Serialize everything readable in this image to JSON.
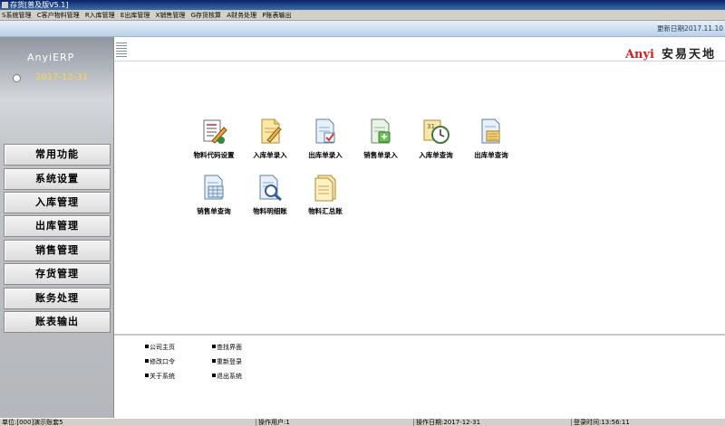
{
  "window": {
    "title": "存货[普及版V5.1]"
  },
  "menu": [
    "S系统管理",
    "C客户物料管理",
    "R入库管理",
    "E出库管理",
    "X销售管理",
    "G存货核算",
    "A财务处理",
    "P账表输出"
  ],
  "header": {
    "update_date": "更新日期2017.11.10"
  },
  "sidebar": {
    "brand": "AnyiERP",
    "date": "2017-12-31",
    "items": [
      "常用功能",
      "系统设置",
      "入库管理",
      "出库管理",
      "销售管理",
      "存货管理",
      "账务处理",
      "账表输出"
    ]
  },
  "main": {
    "logo_latin": "Anyi",
    "logo_cn": "安易天地",
    "shortcuts": [
      {
        "label": "物料代码设置",
        "icon": "material-code-icon"
      },
      {
        "label": "入库单录入",
        "icon": "inbound-entry-icon"
      },
      {
        "label": "出库单录入",
        "icon": "outbound-entry-icon"
      },
      {
        "label": "销售单录入",
        "icon": "sales-entry-icon"
      },
      {
        "label": "入库单查询",
        "icon": "inbound-query-icon"
      },
      {
        "label": "出库单查询",
        "icon": "outbound-query-icon"
      },
      {
        "label": "销售单查询",
        "icon": "sales-query-icon"
      },
      {
        "label": "物料明细账",
        "icon": "material-ledger-icon"
      },
      {
        "label": "物料汇总账",
        "icon": "material-summary-icon"
      }
    ]
  },
  "bottom_links": [
    "公司主页",
    "查找界面",
    "修改口令",
    "重新登录",
    "关于系统",
    "退出系统"
  ],
  "status": {
    "unit": "单位:[000]演示账套5",
    "operator": "操作用户:1",
    "op_date": "操作日期:2017-12-31",
    "login_time": "登录时间:13:56:11"
  },
  "colors": {
    "title_blue": "#0a246a",
    "logo_red": "#d61f1f",
    "sidebar_date": "#ffd34d"
  }
}
